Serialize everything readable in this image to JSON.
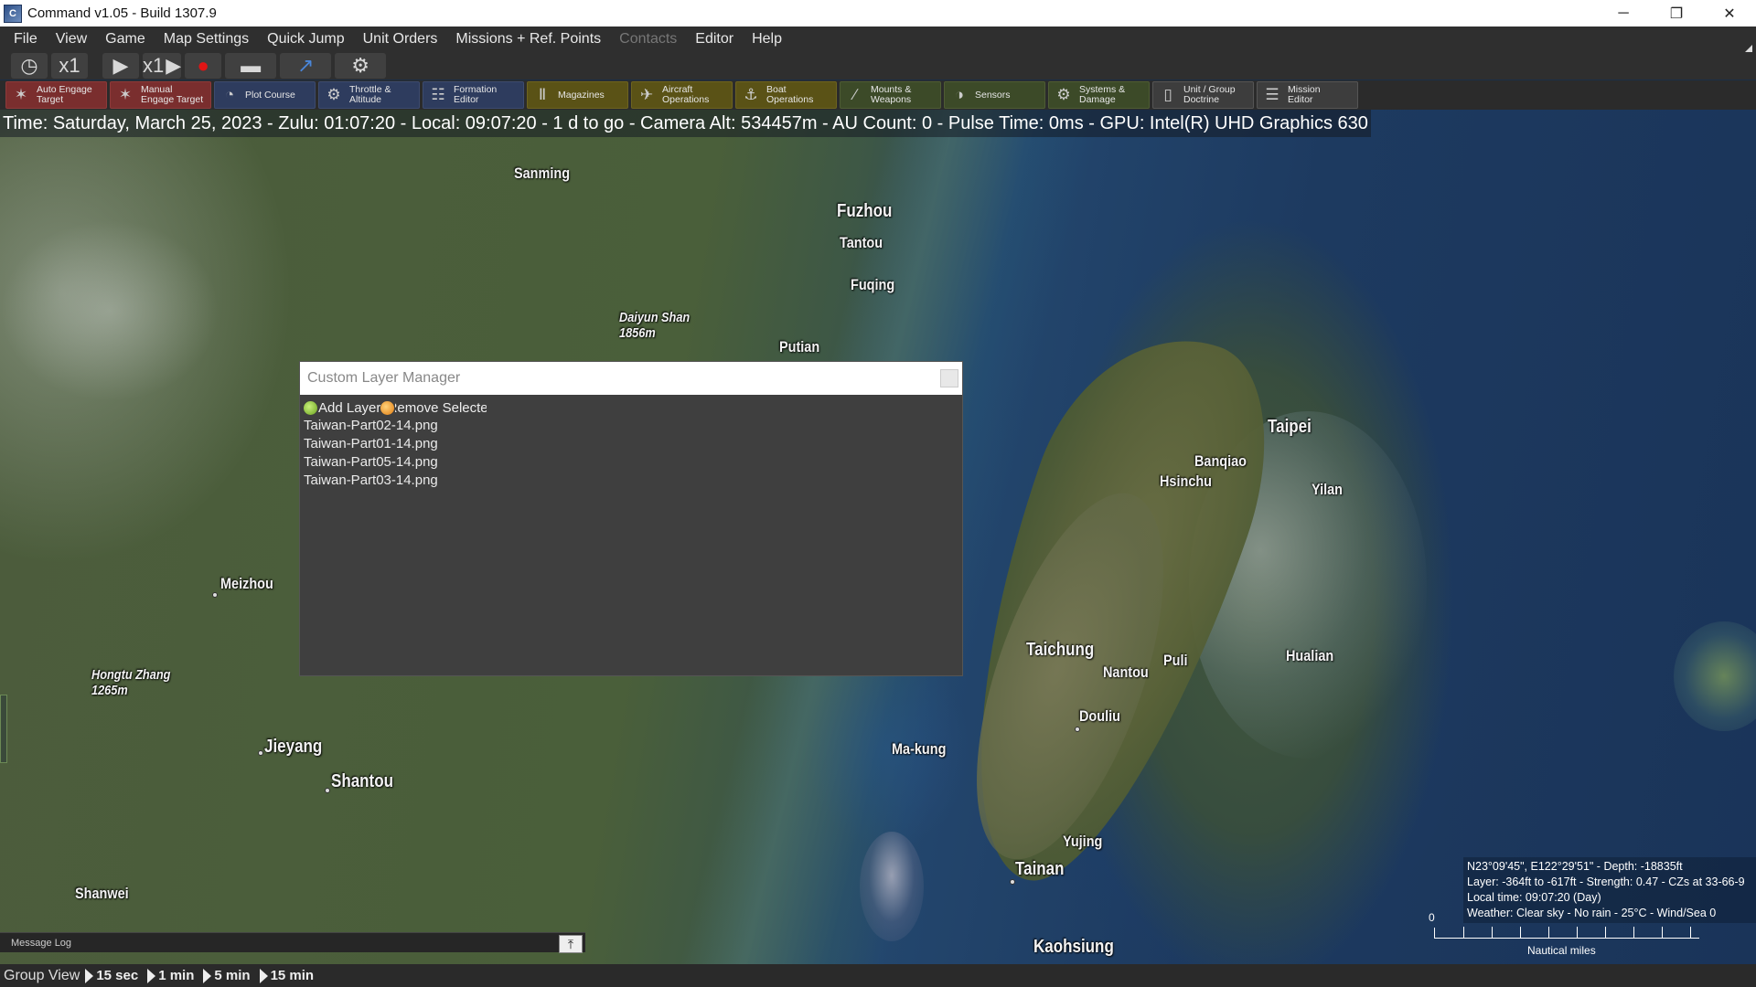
{
  "window": {
    "title": "Command v1.05 - Build 1307.9",
    "app_icon": "command-app-icon",
    "controls": [
      "minimize",
      "restore",
      "close"
    ]
  },
  "menu": {
    "items": [
      "File",
      "View",
      "Game",
      "Map Settings",
      "Quick Jump",
      "Unit Orders",
      "Missions + Ref. Points",
      "Contacts",
      "Editor",
      "Help"
    ],
    "disabled": [
      "Contacts"
    ]
  },
  "time_controls": {
    "speed_label": "x1",
    "compression_label": "x1",
    "icons": [
      "clock-icon",
      "play-icon",
      "step-forward-icon",
      "record-icon",
      "ship-icon",
      "arrow-icon",
      "gear-icon"
    ]
  },
  "toolbar": {
    "buttons": [
      {
        "label": "Auto Engage\nTarget",
        "icon": "auto-engage-icon"
      },
      {
        "label": "Manual\nEngage Target",
        "icon": "manual-engage-icon"
      },
      {
        "label": "Plot Course",
        "icon": "plot-course-icon"
      },
      {
        "label": "Throttle &\nAltitude",
        "icon": "throttle-icon"
      },
      {
        "label": "Formation\nEditor",
        "icon": "formation-icon"
      },
      {
        "label": "Magazines",
        "icon": "magazines-icon"
      },
      {
        "label": "Aircraft\nOperations",
        "icon": "aircraft-icon"
      },
      {
        "label": "Boat\nOperations",
        "icon": "boat-icon"
      },
      {
        "label": "Mounts &\nWeapons",
        "icon": "mounts-icon"
      },
      {
        "label": "Sensors",
        "icon": "sensors-icon"
      },
      {
        "label": "Systems &\nDamage",
        "icon": "systems-icon"
      },
      {
        "label": "Unit / Group\nDoctrine",
        "icon": "doctrine-icon"
      },
      {
        "label": "Mission\nEditor",
        "icon": "mission-editor-icon"
      }
    ]
  },
  "status_line": "Time: Saturday, March 25, 2023 - Zulu: 01:07:20 - Local: 09:07:20 - 1 d to go -  Camera Alt: 534457m  - AU Count: 0 - Pulse Time: 0ms - GPU: Intel(R) UHD Graphics 630",
  "map": {
    "labels": [
      {
        "name": "Sanming"
      },
      {
        "name": "Fuzhou"
      },
      {
        "name": "Tantou"
      },
      {
        "name": "Fuqing"
      },
      {
        "name": "Daiyun Shan\n1856m"
      },
      {
        "name": "Putian"
      },
      {
        "name": "Meizhou"
      },
      {
        "name": "Hongtu Zhang\n1265m"
      },
      {
        "name": "Jieyang"
      },
      {
        "name": "Shantou"
      },
      {
        "name": "Shanwei"
      },
      {
        "name": "Taipei"
      },
      {
        "name": "Banqiao"
      },
      {
        "name": "Hsinchu"
      },
      {
        "name": "Yilan"
      },
      {
        "name": "Taichung"
      },
      {
        "name": "Nantou"
      },
      {
        "name": "Puli"
      },
      {
        "name": "Hualian"
      },
      {
        "name": "Douliu"
      },
      {
        "name": "Ma-kung"
      },
      {
        "name": "Yujing"
      },
      {
        "name": "Tainan"
      },
      {
        "name": "Kaohsiung"
      }
    ]
  },
  "layer_manager": {
    "title": "Custom Layer Manager",
    "add_label": "Add Layer",
    "remove_label": "Remove Selected",
    "layers": [
      "Taiwan-Part02-14.png",
      "Taiwan-Part01-14.png",
      "Taiwan-Part05-14.png",
      "Taiwan-Part03-14.png"
    ]
  },
  "message_log": {
    "title": "Message Log"
  },
  "coord_info": {
    "line1": "N23°09'45\", E122°29'51\" - Depth: -18835ft",
    "line2": "Layer: -364ft to -617ft - Strength: 0.47 - CZs at 33-66-9",
    "line3": "Local time: 09:07:20 (Day)",
    "line4": "Weather: Clear sky - No rain - 25°C - Wind/Sea 0"
  },
  "scale": {
    "zero": "0",
    "unit": "Nautical miles"
  },
  "bottom_bar": {
    "group_view": "Group View",
    "steps": [
      "15 sec",
      "1 min",
      "5 min",
      "15 min"
    ]
  }
}
